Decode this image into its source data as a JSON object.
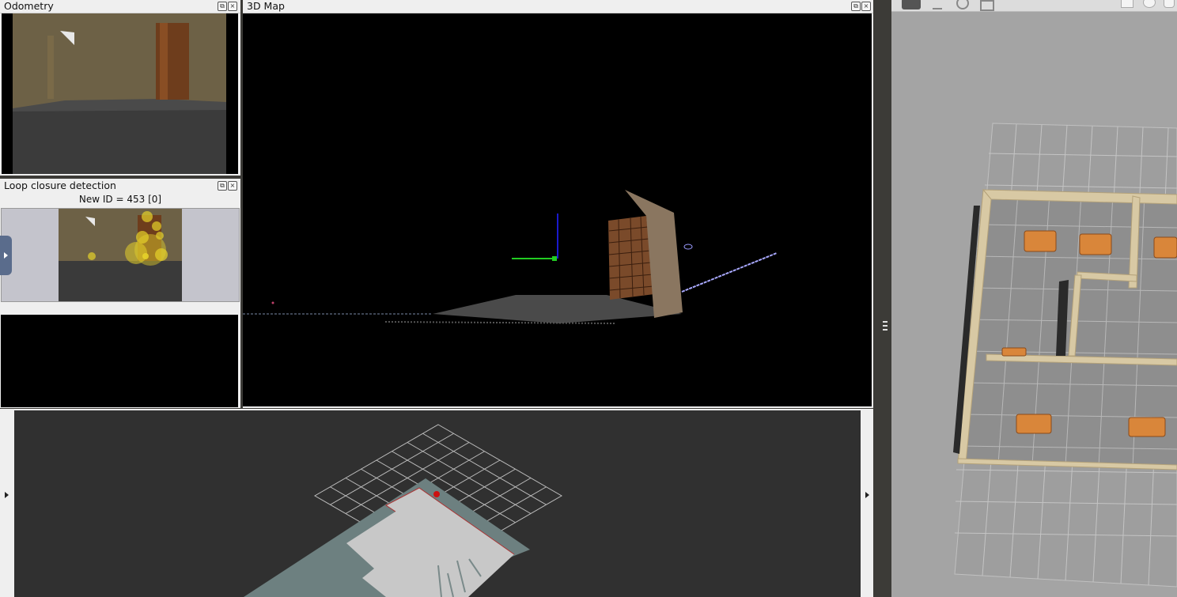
{
  "panels": {
    "odometry": {
      "title": "Odometry"
    },
    "map3d": {
      "title": "3D Map"
    },
    "loop_closure": {
      "title": "Loop closure detection",
      "status": "New ID = 453 [0]"
    }
  },
  "icons": {
    "float": "⧉",
    "close": "×"
  },
  "colors": {
    "panel_bg": "#efefef",
    "view_bg": "#000000",
    "grid_view_bg": "#303030",
    "gazebo_bg": "#a4a4a4",
    "accent_green": "#22cc22",
    "accent_blue": "#1a1acc"
  }
}
